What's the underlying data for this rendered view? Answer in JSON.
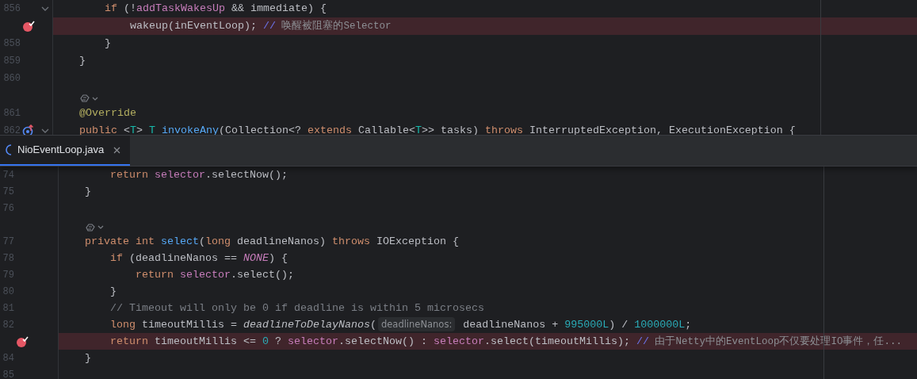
{
  "top_pane": {
    "lines": [
      {
        "kind": "code",
        "number": "856",
        "foldable": true,
        "breakpoint": false,
        "override_marker": false,
        "highlighted": false,
        "tokens": [
          {
            "kind": "kw",
            "text": "    if"
          },
          {
            "kind": "plain",
            "text": " (!"
          },
          {
            "kind": "field",
            "text": "addTaskWakesUp"
          },
          {
            "kind": "plain",
            "text": " && immediate) {"
          }
        ]
      },
      {
        "kind": "code",
        "foldable": false,
        "breakpoint": true,
        "override_marker": false,
        "highlighted": true,
        "tokens": [
          {
            "kind": "plain",
            "text": "        wakeup(inEventLoop); "
          },
          {
            "kind": "slash",
            "text": "//"
          },
          {
            "kind": "note",
            "text": " 唤醒被阻塞的Selector"
          }
        ]
      },
      {
        "kind": "code",
        "number": "858",
        "foldable": false,
        "breakpoint": false,
        "override_marker": false,
        "highlighted": false,
        "tokens": [
          {
            "kind": "plain",
            "text": "    }"
          }
        ]
      },
      {
        "kind": "code",
        "number": "859",
        "foldable": false,
        "breakpoint": false,
        "override_marker": false,
        "highlighted": false,
        "tokens": [
          {
            "kind": "plain",
            "text": "}"
          }
        ]
      },
      {
        "kind": "code",
        "number": "860",
        "foldable": false,
        "breakpoint": false,
        "override_marker": false,
        "highlighted": false
      },
      {
        "kind": "inlay"
      },
      {
        "kind": "code",
        "number": "861",
        "foldable": false,
        "breakpoint": false,
        "override_marker": false,
        "highlighted": false,
        "tokens": [
          {
            "kind": "anno",
            "text": "@Override"
          }
        ]
      },
      {
        "kind": "code",
        "number": "862",
        "foldable": true,
        "breakpoint": false,
        "override_marker": true,
        "highlighted": false,
        "tokens": [
          {
            "kind": "kw",
            "text": "public"
          },
          {
            "kind": "plain",
            "text": " <"
          },
          {
            "kind": "tparam",
            "text": "T"
          },
          {
            "kind": "plain",
            "text": "> "
          },
          {
            "kind": "tparam",
            "text": "T "
          },
          {
            "kind": "method",
            "text": "invokeAny"
          },
          {
            "kind": "plain",
            "text": "(Collection<? "
          },
          {
            "kind": "kw",
            "text": "extends"
          },
          {
            "kind": "plain",
            "text": " Callable<"
          },
          {
            "kind": "tparam",
            "text": "T"
          },
          {
            "kind": "plain",
            "text": ">> tasks) "
          },
          {
            "kind": "kw",
            "text": "throws"
          },
          {
            "kind": "plain",
            "text": " InterruptedException, ExecutionException {"
          }
        ]
      }
    ]
  },
  "tab": {
    "label": "NioEventLoop.java",
    "selected": true
  },
  "bottom_pane": {
    "lines": [
      {
        "kind": "code",
        "number": "74",
        "foldable": false,
        "breakpoint": false,
        "override_marker": false,
        "highlighted": false,
        "tokens": [
          {
            "kind": "kw",
            "text": "    return "
          },
          {
            "kind": "field",
            "text": "selector"
          },
          {
            "kind": "plain",
            "text": ".selectNow();"
          }
        ]
      },
      {
        "kind": "code",
        "number": "75",
        "foldable": false,
        "breakpoint": false,
        "override_marker": false,
        "highlighted": false,
        "tokens": [
          {
            "kind": "plain",
            "text": "}"
          }
        ]
      },
      {
        "kind": "code",
        "number": "76",
        "foldable": false,
        "breakpoint": false,
        "override_marker": false,
        "highlighted": false
      },
      {
        "kind": "inlay"
      },
      {
        "kind": "code",
        "number": "77",
        "foldable": false,
        "breakpoint": false,
        "override_marker": false,
        "highlighted": false,
        "tokens": [
          {
            "kind": "kw",
            "text": "private int "
          },
          {
            "kind": "method",
            "text": "select"
          },
          {
            "kind": "plain",
            "text": "("
          },
          {
            "kind": "kw",
            "text": "long"
          },
          {
            "kind": "plain",
            "text": " deadlineNanos) "
          },
          {
            "kind": "kw",
            "text": "throws"
          },
          {
            "kind": "plain",
            "text": " IOException {"
          }
        ]
      },
      {
        "kind": "code",
        "number": "78",
        "foldable": false,
        "breakpoint": false,
        "override_marker": false,
        "highlighted": false,
        "tokens": [
          {
            "kind": "kw",
            "text": "    if"
          },
          {
            "kind": "plain",
            "text": " (deadlineNanos == "
          },
          {
            "kind": "static_i",
            "text": "NONE"
          },
          {
            "kind": "plain",
            "text": ") {"
          }
        ]
      },
      {
        "kind": "code",
        "number": "79",
        "foldable": false,
        "breakpoint": false,
        "override_marker": false,
        "highlighted": false,
        "tokens": [
          {
            "kind": "kw",
            "text": "        return "
          },
          {
            "kind": "field",
            "text": "selector"
          },
          {
            "kind": "plain",
            "text": ".select();"
          }
        ]
      },
      {
        "kind": "code",
        "number": "80",
        "foldable": false,
        "breakpoint": false,
        "override_marker": false,
        "highlighted": false,
        "tokens": [
          {
            "kind": "plain",
            "text": "    }"
          }
        ]
      },
      {
        "kind": "code",
        "number": "81",
        "foldable": false,
        "breakpoint": false,
        "override_marker": false,
        "highlighted": false,
        "tokens": [
          {
            "kind": "comment",
            "text": "    // Timeout will only be 0 if deadline is within 5 microsecs"
          }
        ]
      },
      {
        "kind": "code",
        "number": "82",
        "foldable": false,
        "breakpoint": false,
        "override_marker": false,
        "highlighted": false,
        "tokens": [
          {
            "kind": "kw",
            "text": "    long"
          },
          {
            "kind": "plain",
            "text": " timeoutMillis = "
          },
          {
            "kind": "call_i",
            "text": "deadlineToDelayNanos"
          },
          {
            "kind": "plain",
            "text": "("
          },
          {
            "kind": "hint",
            "text": "deadlineNanos:"
          },
          {
            "kind": "plain",
            "text": " deadlineNanos + "
          },
          {
            "kind": "num",
            "text": "995000L"
          },
          {
            "kind": "plain",
            "text": ") / "
          },
          {
            "kind": "num",
            "text": "1000000L"
          },
          {
            "kind": "plain",
            "text": ";"
          }
        ]
      },
      {
        "kind": "code",
        "foldable": false,
        "breakpoint": true,
        "override_marker": false,
        "highlighted": true,
        "tokens": [
          {
            "kind": "kw",
            "text": "    return"
          },
          {
            "kind": "plain",
            "text": " timeoutMillis <= "
          },
          {
            "kind": "num",
            "text": "0"
          },
          {
            "kind": "plain",
            "text": " ? "
          },
          {
            "kind": "field",
            "text": "selector"
          },
          {
            "kind": "plain",
            "text": ".selectNow() : "
          },
          {
            "kind": "field",
            "text": "selector"
          },
          {
            "kind": "plain",
            "text": ".select(timeoutMillis); "
          },
          {
            "kind": "slash",
            "text": "//"
          },
          {
            "kind": "note",
            "text": " 由于Netty中的EventLoop不仅要处理IO事件，任..."
          }
        ]
      },
      {
        "kind": "code",
        "number": "84",
        "foldable": false,
        "breakpoint": false,
        "override_marker": false,
        "highlighted": false,
        "tokens": [
          {
            "kind": "plain",
            "text": "}"
          }
        ]
      },
      {
        "kind": "code",
        "number": "85",
        "foldable": false,
        "breakpoint": false,
        "override_marker": false,
        "highlighted": false
      }
    ]
  }
}
